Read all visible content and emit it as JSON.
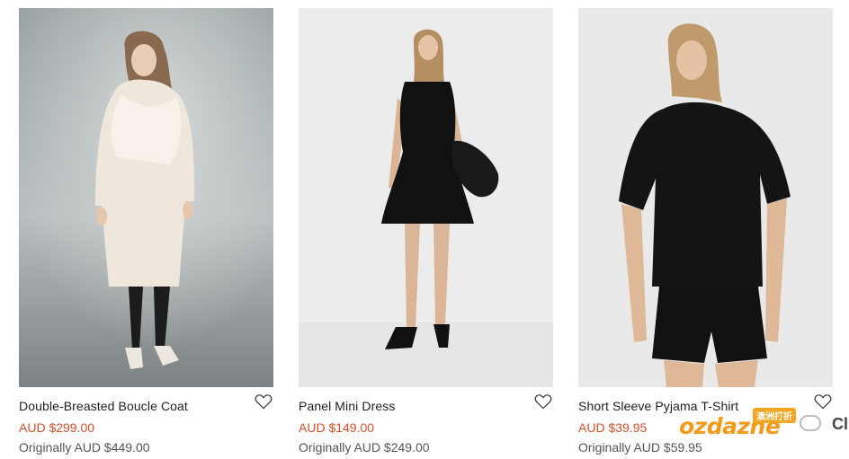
{
  "products": [
    {
      "title": "Double-Breasted Boucle Coat",
      "price": "AUD $299.00",
      "original_price": "Originally AUD $449.00",
      "wishlist_icon": "heart-outline-icon"
    },
    {
      "title": "Panel Mini Dress",
      "price": "AUD $149.00",
      "original_price": "Originally AUD $249.00",
      "wishlist_icon": "heart-outline-icon"
    },
    {
      "title": "Short Sleeve Pyjama T-Shirt",
      "price": "AUD $39.95",
      "original_price": "Originally AUD $59.95",
      "wishlist_icon": "heart-outline-icon"
    }
  ],
  "colors": {
    "sale_price": "#d4502a",
    "original_price": "#555555",
    "title": "#1f1f1f"
  },
  "watermark": {
    "logo_text": "ozdazhe",
    "badge_text": "澳洲打折",
    "corner_text": "Cl"
  }
}
